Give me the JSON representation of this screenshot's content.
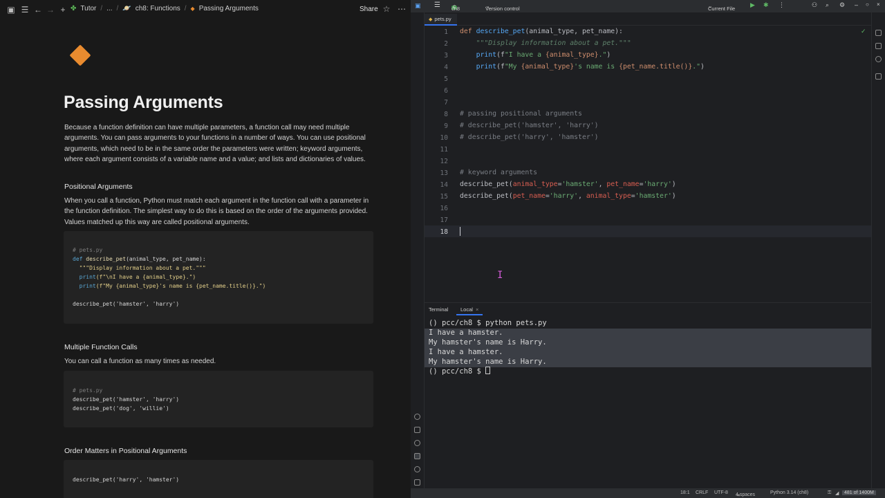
{
  "notes": {
    "breadcrumb": {
      "workspace": "Tutor",
      "ellipsis": "...",
      "parent": "ch8: Functions",
      "page": "Passing Arguments"
    },
    "share_label": "Share",
    "title": "Passing Arguments",
    "intro": "Because a function definition can have multiple parameters, a function call may need multiple arguments. You can pass arguments to your functions in a number of ways. You can use positional arguments, which need to be in the same order the parameters were written; keyword arguments, where each argument consists of a variable name and a value; and lists and dictionaries of values.",
    "section1": {
      "heading": "Positional Arguments",
      "text": "When you call a function, Python must match each argument in the function call with a parameter in the function definition. The simplest way to do this is based on the order of the arguments provided. Values matched up this way are called positional arguments.",
      "code": {
        "comment": "# pets.py",
        "l2_kw": "def ",
        "l2_fn": "describe_pet",
        "l2_rest": "(animal_type, pet_name):",
        "l3": "  \"\"\"Display information about a pet.\"\"\"",
        "l4_fn": "  print",
        "l4_rest": "(f\"\\nI have a {animal_type}.\")",
        "l5_fn": "  print",
        "l5_rest": "(f\"My {animal_type}'s name is {pet_name.title()}.\")",
        "l7": "describe_pet('hamster', 'harry')"
      }
    },
    "section2": {
      "heading": "Multiple Function Calls",
      "text": "You can call a function as many times as needed.",
      "code": {
        "comment": "# pets.py",
        "l2": "describe_pet('hamster', 'harry')",
        "l3": "describe_pet('dog', 'willie')"
      }
    },
    "section3": {
      "heading": "Order Matters in Positional Arguments",
      "code": {
        "l1": "describe_pet('harry', 'hamster')"
      }
    }
  },
  "ide": {
    "project": "ch8",
    "project_badge": "C",
    "vcs": "Version control",
    "run_config": "Current File",
    "tab": "pets.py",
    "line_numbers": [
      "1",
      "2",
      "3",
      "4",
      "5",
      "6",
      "7",
      "8",
      "9",
      "10",
      "11",
      "12",
      "13",
      "14",
      "15",
      "16",
      "17",
      "18"
    ],
    "code": {
      "l1_kw": "def ",
      "l1_fn": "describe_pet",
      "l1_rest": "(animal_type, pet_name):",
      "l2": "    \"\"\"Display information about a pet.\"\"\"",
      "l3_fn": "    print",
      "l3_a": "(f",
      "l3_s": "\"I have a ",
      "l3_t": "{animal_type}",
      "l3_e": ".\"",
      "l3_c": ")",
      "l4_fn": "    print",
      "l4_a": "(f",
      "l4_s1": "\"My ",
      "l4_t1": "{animal_type}",
      "l4_s2": "'s name is ",
      "l4_t2": "{pet_name.title()}",
      "l4_e": ".\"",
      "l4_c": ")",
      "l8": "# passing positional arguments",
      "l9": "# describe_pet('hamster', 'harry')",
      "l10": "# describe_pet('harry', 'hamster')",
      "l13": "# keyword arguments",
      "l14_fn": "describe_pet(",
      "l14_k1": "animal_type",
      "l14_v1": "'hamster'",
      "l14_k2": "pet_name",
      "l14_v2": "'harry'",
      "l15_fn": "describe_pet(",
      "l15_k1": "pet_name",
      "l15_v1": "'harry'",
      "l15_k2": "animal_type",
      "l15_v2": "'hamster'"
    },
    "terminal": {
      "tab_terminal": "Terminal",
      "tab_local": "Local",
      "lines": [
        "() pcc/ch8 $ python pets.py",
        "I have a hamster.",
        "My hamster's name is Harry.",
        "I have a hamster.",
        "My hamster's name is Harry.",
        "() pcc/ch8 $ "
      ]
    },
    "status": {
      "position": "18:1",
      "line_sep": "CRLF",
      "encoding": "UTF-8",
      "indent": "4 spaces",
      "interpreter": "Python 3.14 (ch8)",
      "memory": "481 of 1400M"
    }
  }
}
